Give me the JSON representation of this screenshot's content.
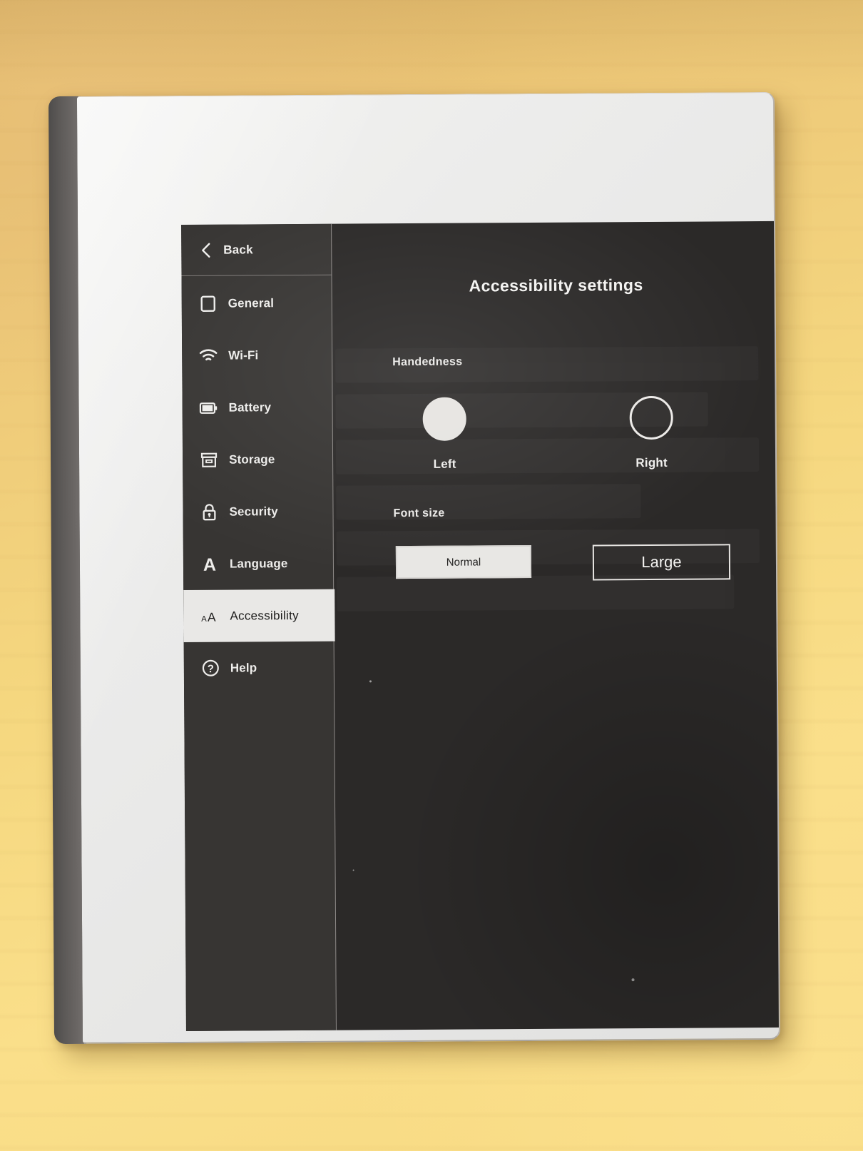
{
  "device": {
    "type": "e-ink-tablet"
  },
  "sidebar": {
    "back": {
      "label": "Back",
      "icon": "chevron-left-icon"
    },
    "items": [
      {
        "label": "General",
        "icon": "square-outline-icon",
        "active": false
      },
      {
        "label": "Wi-Fi",
        "icon": "wifi-icon",
        "active": false
      },
      {
        "label": "Battery",
        "icon": "battery-icon",
        "active": false
      },
      {
        "label": "Storage",
        "icon": "storage-box-icon",
        "active": false
      },
      {
        "label": "Security",
        "icon": "lock-icon",
        "active": false
      },
      {
        "label": "Language",
        "icon": "letter-a-icon",
        "active": false
      },
      {
        "label": "Accessibility",
        "icon": "aa-text-size-icon",
        "active": true
      },
      {
        "label": "Help",
        "icon": "question-circle-icon",
        "active": false
      }
    ]
  },
  "main": {
    "title": "Accessibility settings",
    "handedness": {
      "label": "Handedness",
      "selected": "Left",
      "options": [
        {
          "label": "Left",
          "selected": true
        },
        {
          "label": "Right",
          "selected": false
        }
      ]
    },
    "font_size": {
      "label": "Font size",
      "selected": "Normal",
      "options": [
        {
          "label": "Normal",
          "selected": true
        },
        {
          "label": "Large",
          "selected": false
        }
      ]
    }
  },
  "colors": {
    "screen_background": "#2b2928",
    "sidebar_background": "#373533",
    "active_item_background": "#e9e8e6",
    "text_light": "#f0efed",
    "text_dark": "#1d1c1b",
    "bezel": "#ececeb",
    "desk": "#f0cd7c"
  }
}
